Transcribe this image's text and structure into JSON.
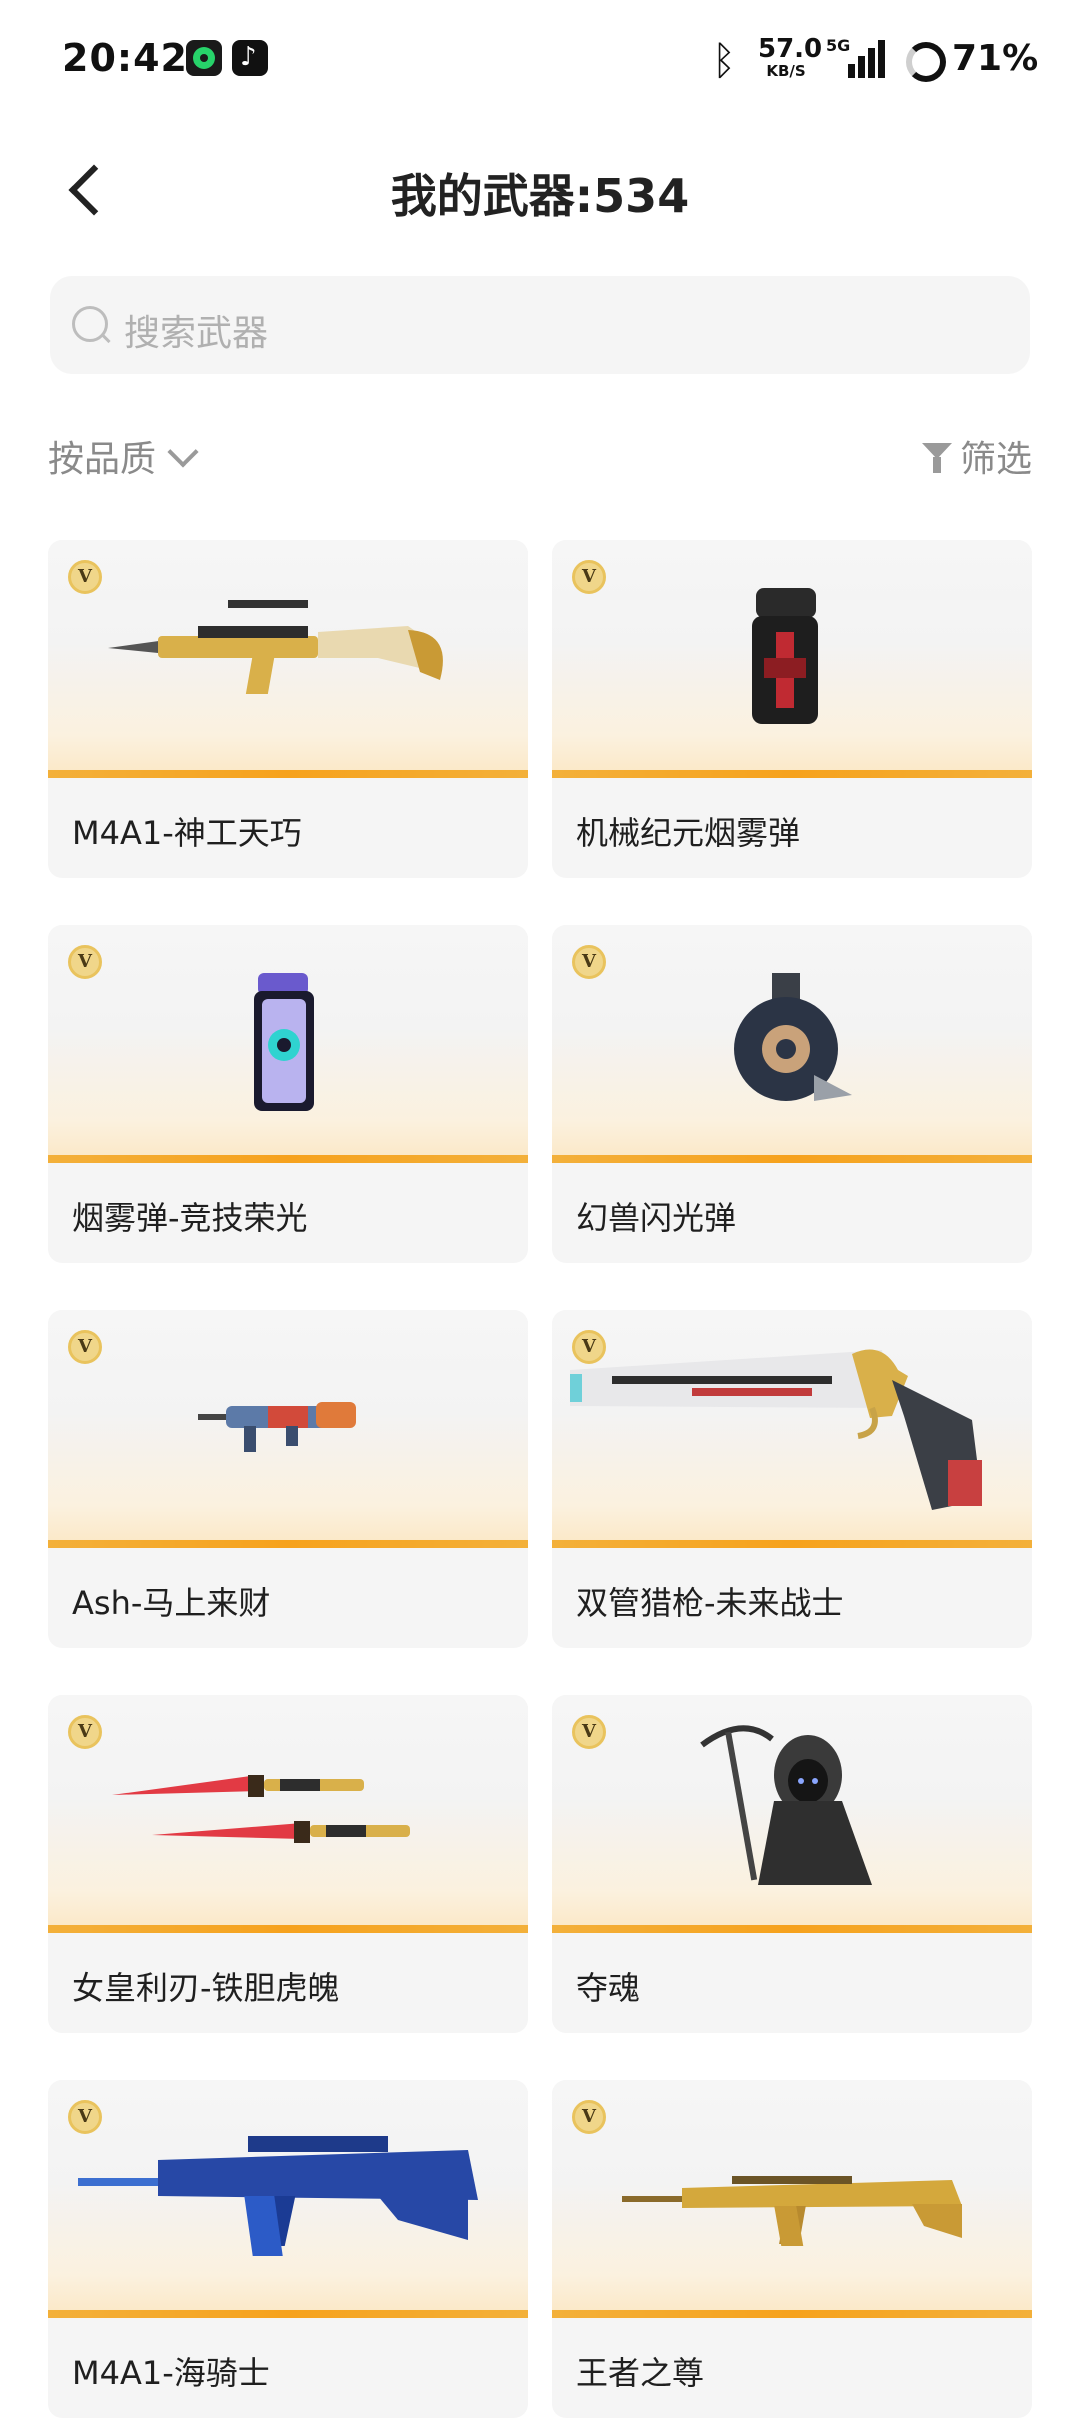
{
  "status_bar": {
    "time": "20:42",
    "speed_value": "57.0",
    "speed_unit": "KB/S",
    "network_label": "5G",
    "battery": "71%",
    "icons": [
      "app-icon",
      "tiktok-icon",
      "bluetooth-icon",
      "signal-icon",
      "battery-icon"
    ]
  },
  "header": {
    "title": "我的武器:534",
    "back_icon": "chevron-left-icon"
  },
  "search": {
    "placeholder": "搜索武器",
    "icon": "search-icon"
  },
  "controls": {
    "sort_label": "按品质",
    "filter_label": "筛选"
  },
  "colors": {
    "accent_stripe": "#f6a21d",
    "badge": "#f0d68a"
  },
  "badge_glyph": "V",
  "items": [
    {
      "name": "M4A1-神工天巧"
    },
    {
      "name": "机械纪元烟雾弹"
    },
    {
      "name": "烟雾弹-竞技荣光"
    },
    {
      "name": "幻兽闪光弹"
    },
    {
      "name": "Ash-马上来财"
    },
    {
      "name": "双管猎枪-未来战士"
    },
    {
      "name": "女皇利刃-铁胆虎魄"
    },
    {
      "name": "夺魂"
    },
    {
      "name": "M4A1-海骑士"
    },
    {
      "name": "王者之尊"
    }
  ]
}
